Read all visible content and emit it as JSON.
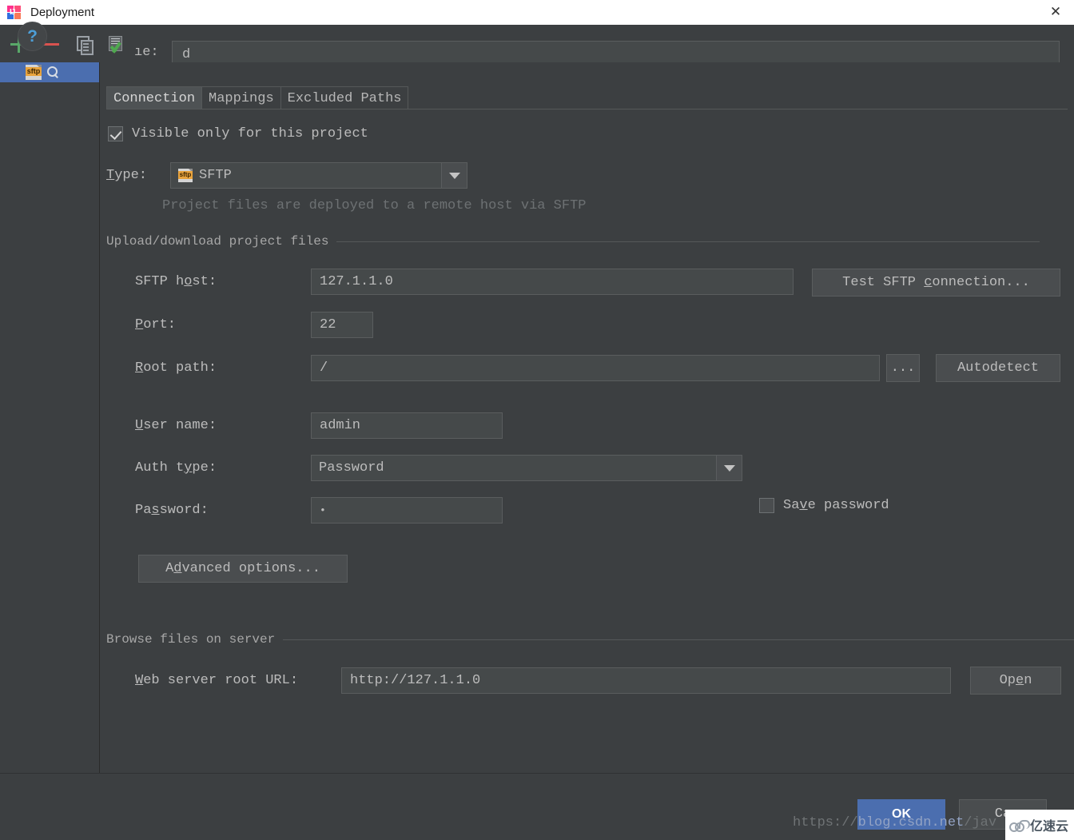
{
  "window": {
    "title": "Deployment",
    "app_icon": "intellij-idea-icon",
    "close_icon": "close-icon"
  },
  "toolbar": {
    "add_icon": "plus-icon",
    "remove_icon": "minus-icon",
    "copy_icon": "copy-icon",
    "validate_icon": "validate-icon",
    "name_label": "ıe:",
    "name_value": "d",
    "name_placeholder": ""
  },
  "sidebar": {
    "items": [
      {
        "label": "",
        "type_icon": "sftp-file-icon",
        "search_icon": "magnifier-icon",
        "selected": true
      }
    ]
  },
  "tabs": [
    {
      "label": "Connection",
      "active": true
    },
    {
      "label": "Mappings",
      "active": false
    },
    {
      "label": "Excluded Paths",
      "active": false
    }
  ],
  "connection": {
    "visible_only_checkbox": {
      "label": "Visible only for this project",
      "checked": true
    },
    "type": {
      "label": "Type:",
      "mnemonic": "T",
      "value": "SFTP",
      "icon": "sftp-file-icon",
      "dropdown_icon": "chevron-down-icon",
      "hint": "Project files are deployed to a remote host via SFTP"
    },
    "upload_group": {
      "title": "Upload/download project files",
      "host": {
        "label_pre": "SFTP h",
        "label_mnemonic": "o",
        "label_post": "st:",
        "value": "127.1.1.0"
      },
      "test_button": {
        "pre": "Test SFTP ",
        "mnemonic": "c",
        "post": "onnection..."
      },
      "port": {
        "label_pre": "",
        "label_mnemonic": "P",
        "label_post": "ort:",
        "value": "22"
      },
      "root_path": {
        "label_pre": "",
        "label_mnemonic": "R",
        "label_post": "oot path:",
        "value": "/",
        "browse_button": "...",
        "autodetect_button": "Autodetect"
      },
      "user_name": {
        "label_pre": "",
        "label_mnemonic": "U",
        "label_post": "ser name:",
        "value": "admin"
      },
      "auth_type": {
        "label_pre": "Auth t",
        "label_mnemonic": "y",
        "label_post": "pe:",
        "value": "Password",
        "dropdown_icon": "chevron-down-icon"
      },
      "password": {
        "label_pre": "Pa",
        "label_mnemonic": "s",
        "label_post": "sword:",
        "value": "•"
      },
      "save_password": {
        "label_pre": "Sa",
        "label_mnemonic": "v",
        "label_post": "e password",
        "checked": false
      },
      "advanced_button": {
        "pre": "A",
        "mnemonic": "d",
        "post": "vanced options..."
      }
    },
    "browse_group": {
      "title": "Browse files on server",
      "web_url": {
        "label_pre": "",
        "label_mnemonic": "W",
        "label_post": "eb server root URL:",
        "value": "http://127.1.1.0"
      },
      "open_button": {
        "pre": "Op",
        "mnemonic": "e",
        "post": "n"
      }
    }
  },
  "footer": {
    "help_icon": "question-mark-icon",
    "ok_label": "OK",
    "cancel_label": "Ca",
    "watermark_url_pre": "https://",
    "watermark_url_hl": "blog.csdn.net",
    "watermark_url_post": "/jav",
    "brand_text": "亿速云",
    "brand_icon": "cloud-icon"
  },
  "colors": {
    "background": "#3c3f41",
    "field": "#45494a",
    "accent": "#4b6eaf",
    "text": "#bcbcbc",
    "hint": "#6d7173",
    "green": "#59a869",
    "red": "#d9534f",
    "sftp_tag": "#e8a33d"
  }
}
